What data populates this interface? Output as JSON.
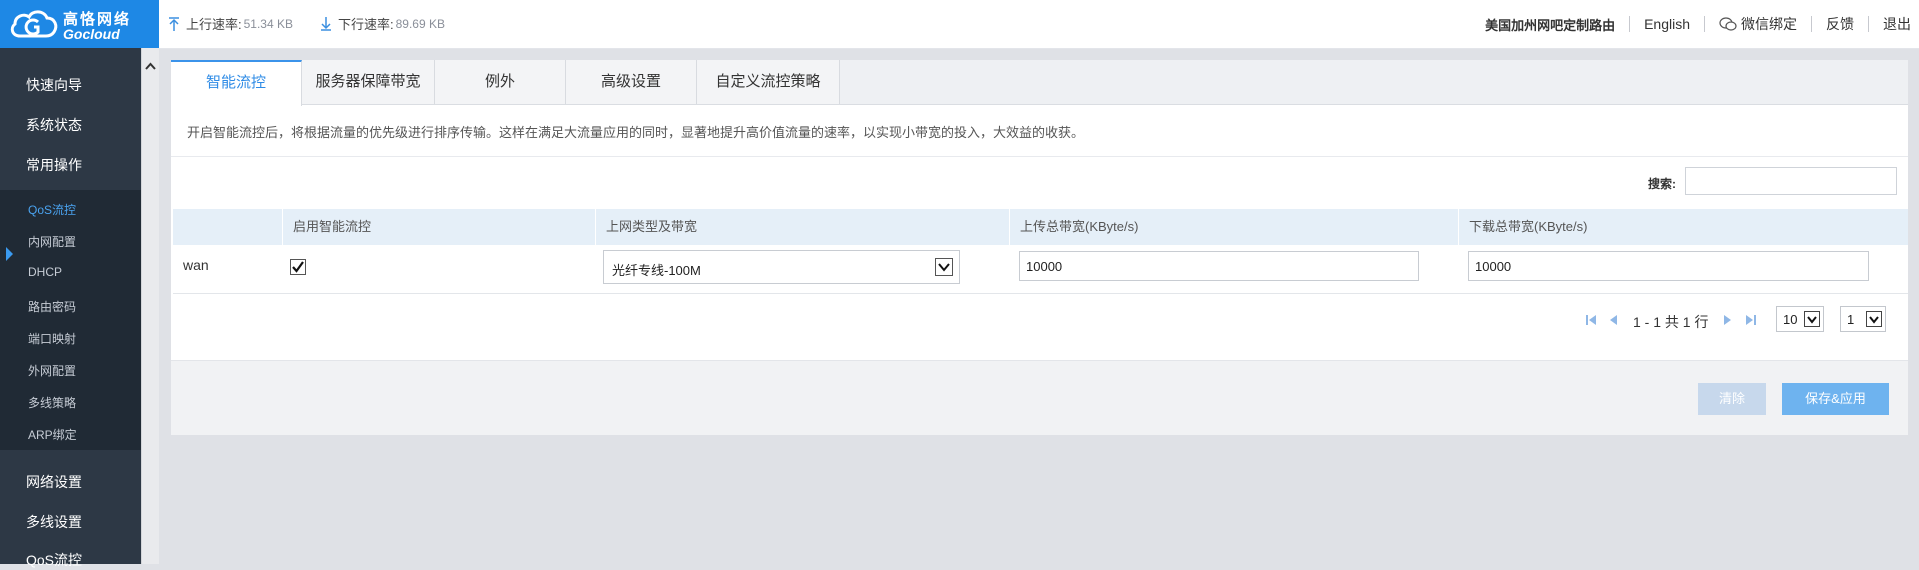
{
  "brand": {
    "name_cn": "高恪网络",
    "name_en": "Gocloud"
  },
  "rates": {
    "upload_label": "上行速率:",
    "upload_value": "51.34 KB",
    "download_label": "下行速率:",
    "download_value": "89.69 KB"
  },
  "topnav": {
    "router_name": "美国加州网吧定制路由",
    "english": "English",
    "wechat": "微信绑定",
    "feedback": "反馈",
    "logout": "退出"
  },
  "sidebar": {
    "main_top": [
      {
        "label": "快速向导"
      },
      {
        "label": "系统状态"
      },
      {
        "label": "常用操作"
      }
    ],
    "sub": [
      {
        "label": "QoS流控",
        "active": true
      },
      {
        "label": "内网配置"
      },
      {
        "label": "DHCP"
      },
      {
        "label": "路由密码"
      },
      {
        "label": "端口映射"
      },
      {
        "label": "外网配置"
      },
      {
        "label": "多线策略"
      },
      {
        "label": "ARP绑定"
      }
    ],
    "main_bottom": [
      {
        "label": "网络设置"
      },
      {
        "label": "多线设置"
      },
      {
        "label": "QoS流控"
      }
    ]
  },
  "tabs": [
    {
      "label": "智能流控",
      "active": true
    },
    {
      "label": "服务器保障带宽"
    },
    {
      "label": "例外"
    },
    {
      "label": "高级设置"
    },
    {
      "label": "自定义流控策略"
    }
  ],
  "description": "开启智能流控后，将根据流量的优先级进行排序传输。这样在满足大流量应用的同时，显著地提升高价值流量的速率，以实现小带宽的投入，大效益的收获。",
  "search": {
    "label": "搜索:",
    "value": ""
  },
  "table": {
    "headers": [
      "",
      "启用智能流控",
      "上网类型及带宽",
      "上传总带宽(KByte/s)",
      "下载总带宽(KByte/s)"
    ],
    "rows": [
      {
        "name": "wan",
        "enabled": true,
        "type": "光纤专线-100M",
        "upload": "10000",
        "download": "10000"
      }
    ]
  },
  "pagination": {
    "summary": "1 - 1 共 1 行",
    "page_size": "10",
    "page": "1"
  },
  "buttons": {
    "clear": "清除",
    "save": "保存&应用"
  },
  "colors": {
    "brand_blue": "#1e88e5",
    "sidebar_bg": "#2d3845",
    "accent": "#2e8be6",
    "save_button": "#6eb3ef"
  }
}
